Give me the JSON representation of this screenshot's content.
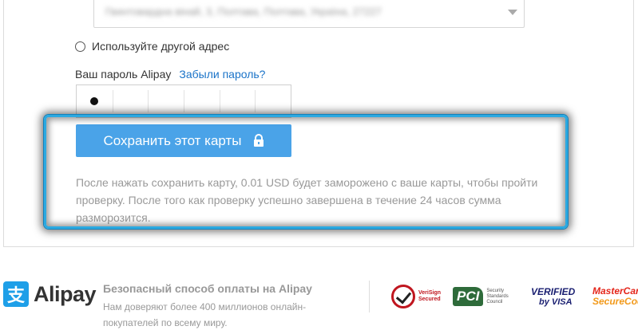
{
  "address": {
    "selected_value": "Гвинтовардна вінай, 3, Полтава, Полтава, Україна, 27227"
  },
  "alternate_address": {
    "radio_label": "Используйте другой адрес"
  },
  "password": {
    "label": "Ваш пароль Alipay",
    "forgot_link": "Забыли пароль?",
    "entered_digits": 1,
    "total_digits": 6
  },
  "save_button": {
    "label": "Сохранить этот карты",
    "icon": "lock-icon"
  },
  "notice": {
    "text": "После нажать сохранить карту, 0.01 USD будет заморожено с ваше карты, чтобы пройти проверку. После того как проверку успешно завершена в течение 24 часов сумма разморозится."
  },
  "footer": {
    "logo_glyph": "支",
    "logo_text": "Alipay",
    "secure_title": "Безопасный способ оплаты на Alipay",
    "secure_description": "Нам доверяют более 400 миллионов онлайн-покупателей по всему миру.",
    "badges": {
      "verisign": [
        "VeriSign",
        "Secured"
      ],
      "pci": {
        "mark": "PCI",
        "text": "Security Standards Council"
      },
      "visa": [
        "VERIFIED",
        "by VISA"
      ],
      "mastercard": [
        "MasterCard.",
        "SecureCode."
      ]
    }
  },
  "colors": {
    "accent": "#4aa3e8",
    "link": "#1a73c8",
    "highlight": "#2ba9e1"
  }
}
